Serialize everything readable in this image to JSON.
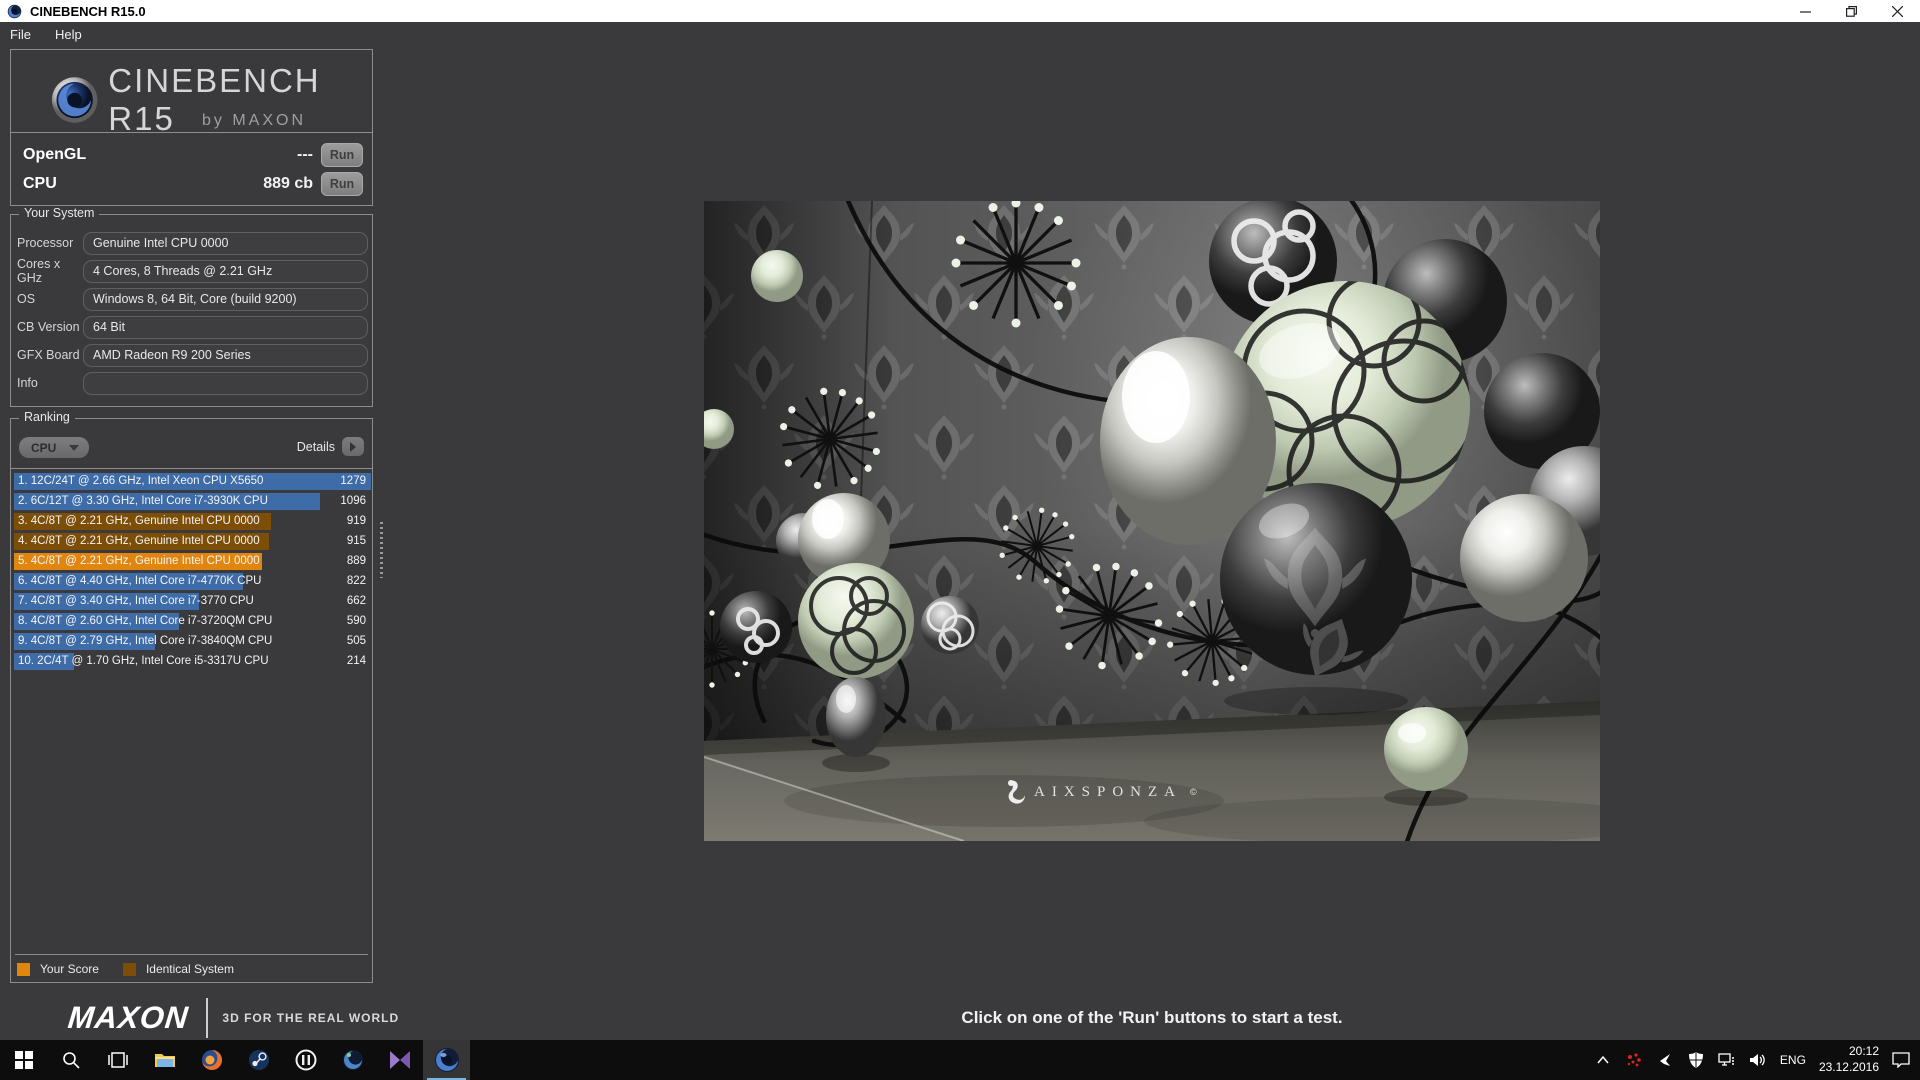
{
  "window": {
    "title": "CINEBENCH R15.0",
    "menu": {
      "file": "File",
      "help": "Help"
    }
  },
  "logo": {
    "title": "CINEBENCH R15",
    "subtitle": "by MAXON"
  },
  "benchmarks": {
    "opengl": {
      "label": "OpenGL",
      "value": "---",
      "run_label": "Run"
    },
    "cpu": {
      "label": "CPU",
      "value": "889 cb",
      "run_label": "Run"
    }
  },
  "your_system": {
    "title": "Your System",
    "fields": [
      {
        "label": "Processor",
        "value": "Genuine Intel CPU 0000"
      },
      {
        "label": "Cores x GHz",
        "value": "4 Cores, 8 Threads @ 2.21 GHz"
      },
      {
        "label": "OS",
        "value": "Windows 8, 64 Bit, Core (build 9200)"
      },
      {
        "label": "CB Version",
        "value": "64 Bit"
      },
      {
        "label": "GFX Board",
        "value": "AMD Radeon R9 200 Series"
      },
      {
        "label": "Info",
        "value": ""
      }
    ]
  },
  "ranking": {
    "title": "Ranking",
    "filter_value": "CPU",
    "details_label": "Details",
    "max_score": 1279,
    "rows": [
      {
        "label": "1. 12C/24T @ 2.66 GHz, Intel Xeon CPU X5650",
        "score": 1279,
        "type": "blue"
      },
      {
        "label": "2. 6C/12T @ 3.30 GHz,  Intel Core i7-3930K CPU",
        "score": 1096,
        "type": "blue"
      },
      {
        "label": "3. 4C/8T @ 2.21 GHz, Genuine Intel CPU 0000",
        "score": 919,
        "type": "identical"
      },
      {
        "label": "4. 4C/8T @ 2.21 GHz, Genuine Intel CPU 0000",
        "score": 915,
        "type": "identical"
      },
      {
        "label": "5. 4C/8T @ 2.21 GHz, Genuine Intel CPU 0000",
        "score": 889,
        "type": "yours"
      },
      {
        "label": "6. 4C/8T @ 4.40 GHz, Intel Core i7-4770K CPU",
        "score": 822,
        "type": "blue"
      },
      {
        "label": "7. 4C/8T @ 3.40 GHz,  Intel Core i7-3770 CPU",
        "score": 662,
        "type": "blue"
      },
      {
        "label": "8. 4C/8T @ 2.60 GHz, Intel Core i7-3720QM CPU",
        "score": 590,
        "type": "blue"
      },
      {
        "label": "9. 4C/8T @ 2.79 GHz,  Intel Core i7-3840QM CPU",
        "score": 505,
        "type": "blue"
      },
      {
        "label": "10. 2C/4T @ 1.70 GHz,  Intel Core i5-3317U CPU",
        "score": 214,
        "type": "blue"
      }
    ],
    "legend": [
      {
        "label": "Your Score",
        "color": "#e0860f"
      },
      {
        "label": "Identical System",
        "color": "#7d4e08"
      }
    ]
  },
  "colors": {
    "blue": "#3d6ca8",
    "identical": "#7d4e08",
    "yours": "#e0860f"
  },
  "footer": {
    "brand": "MAXON",
    "tagline": "3D FOR THE REAL WORLD"
  },
  "viewport": {
    "message": "Click on one of the 'Run' buttons to start a test.",
    "credit": "AIXSPONZA",
    "credit_mark": "©"
  },
  "taskbar": {
    "tray": {
      "lang": "ENG",
      "time": "20:12",
      "date": "23.12.2016"
    }
  }
}
